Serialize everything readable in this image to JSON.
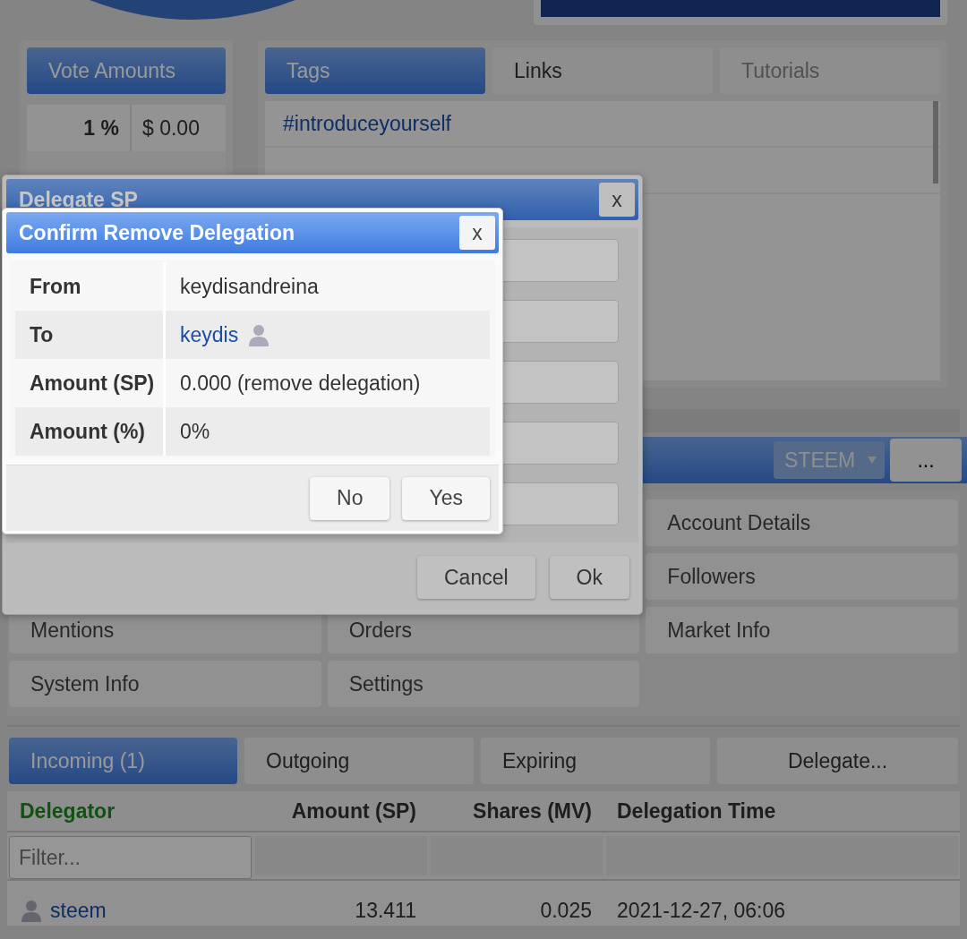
{
  "vote_amounts": {
    "title": "Vote Amounts",
    "rows": [
      {
        "percent": "1 %",
        "value": "$ 0.00"
      }
    ]
  },
  "tag_tabs": [
    {
      "label": "Tags",
      "selected": true,
      "disabled": false
    },
    {
      "label": "Links",
      "selected": false,
      "disabled": false
    },
    {
      "label": "Tutorials",
      "selected": false,
      "disabled": true
    }
  ],
  "tags": [
    "#introduceyourself"
  ],
  "currency_bar": {
    "currency": "STEEM",
    "more": "..."
  },
  "menu": [
    "Account Details",
    "Followers",
    "Mentions",
    "Orders",
    "Market Info",
    "System Info",
    "Settings"
  ],
  "delegation_tabs": [
    {
      "label": "Incoming (1)",
      "selected": true
    },
    {
      "label": "Outgoing",
      "selected": false
    },
    {
      "label": "Expiring",
      "selected": false
    },
    {
      "label": "Delegate...",
      "selected": false
    }
  ],
  "delegations_table": {
    "columns": [
      {
        "label": "Delegator",
        "sorted": true
      },
      {
        "label": "Amount (SP)",
        "sorted": false
      },
      {
        "label": "Shares (MV)",
        "sorted": false
      },
      {
        "label": "Delegation Time",
        "sorted": false
      }
    ],
    "filter_placeholder": "Filter...",
    "rows": [
      {
        "delegator": "steem",
        "amount": "13.411",
        "shares": "0.025",
        "time": "2021-12-27, 06:06"
      }
    ]
  },
  "delegate_dialog": {
    "title": "Delegate SP",
    "close": "x",
    "buttons": [
      "Cancel",
      "Ok"
    ]
  },
  "confirm_dialog": {
    "title": "Confirm Remove Delegation",
    "close": "x",
    "rows": [
      {
        "label": "From",
        "value": "keydisandreina",
        "kind": "text"
      },
      {
        "label": "To",
        "value": "keydis",
        "kind": "user"
      },
      {
        "label": "Amount (SP)",
        "value": "0.000 (remove delegation)",
        "kind": "text"
      },
      {
        "label": "Amount (%)",
        "value": "0%",
        "kind": "text"
      }
    ],
    "buttons": [
      "No",
      "Yes"
    ]
  }
}
